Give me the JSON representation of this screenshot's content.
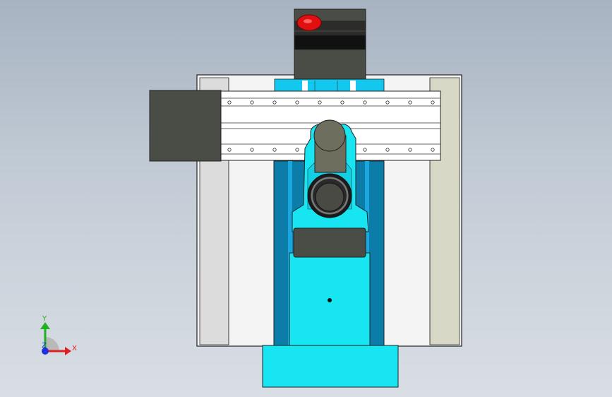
{
  "viewport": {
    "background_top": "#a8b3c2",
    "background_bottom": "#d9dee4"
  },
  "triad": {
    "x_label": "X",
    "y_label": "Y",
    "z_label": "Z",
    "x_color": "#e02020",
    "y_color": "#20b020",
    "z_color": "#2030e0"
  },
  "model": {
    "base_color": "#f2f2f2",
    "side_left_color": "#dedede",
    "side_right_color": "#d8d8c8",
    "rail_color": "#0a7fa8",
    "rail_light_color": "#1aa8e0",
    "table_color": "#17e6f2",
    "housing_color": "#4a4c46",
    "motor_color": "#6e6e5e",
    "knob_color": "#e01010"
  }
}
